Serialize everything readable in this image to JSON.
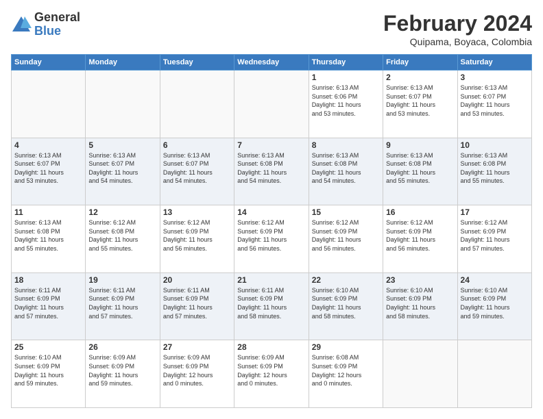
{
  "header": {
    "logo_general": "General",
    "logo_blue": "Blue",
    "title": "February 2024",
    "location": "Quipama, Boyaca, Colombia"
  },
  "days_of_week": [
    "Sunday",
    "Monday",
    "Tuesday",
    "Wednesday",
    "Thursday",
    "Friday",
    "Saturday"
  ],
  "weeks": [
    [
      {
        "num": "",
        "info": ""
      },
      {
        "num": "",
        "info": ""
      },
      {
        "num": "",
        "info": ""
      },
      {
        "num": "",
        "info": ""
      },
      {
        "num": "1",
        "info": "Sunrise: 6:13 AM\nSunset: 6:06 PM\nDaylight: 11 hours\nand 53 minutes."
      },
      {
        "num": "2",
        "info": "Sunrise: 6:13 AM\nSunset: 6:07 PM\nDaylight: 11 hours\nand 53 minutes."
      },
      {
        "num": "3",
        "info": "Sunrise: 6:13 AM\nSunset: 6:07 PM\nDaylight: 11 hours\nand 53 minutes."
      }
    ],
    [
      {
        "num": "4",
        "info": "Sunrise: 6:13 AM\nSunset: 6:07 PM\nDaylight: 11 hours\nand 53 minutes."
      },
      {
        "num": "5",
        "info": "Sunrise: 6:13 AM\nSunset: 6:07 PM\nDaylight: 11 hours\nand 54 minutes."
      },
      {
        "num": "6",
        "info": "Sunrise: 6:13 AM\nSunset: 6:07 PM\nDaylight: 11 hours\nand 54 minutes."
      },
      {
        "num": "7",
        "info": "Sunrise: 6:13 AM\nSunset: 6:08 PM\nDaylight: 11 hours\nand 54 minutes."
      },
      {
        "num": "8",
        "info": "Sunrise: 6:13 AM\nSunset: 6:08 PM\nDaylight: 11 hours\nand 54 minutes."
      },
      {
        "num": "9",
        "info": "Sunrise: 6:13 AM\nSunset: 6:08 PM\nDaylight: 11 hours\nand 55 minutes."
      },
      {
        "num": "10",
        "info": "Sunrise: 6:13 AM\nSunset: 6:08 PM\nDaylight: 11 hours\nand 55 minutes."
      }
    ],
    [
      {
        "num": "11",
        "info": "Sunrise: 6:13 AM\nSunset: 6:08 PM\nDaylight: 11 hours\nand 55 minutes."
      },
      {
        "num": "12",
        "info": "Sunrise: 6:12 AM\nSunset: 6:08 PM\nDaylight: 11 hours\nand 55 minutes."
      },
      {
        "num": "13",
        "info": "Sunrise: 6:12 AM\nSunset: 6:09 PM\nDaylight: 11 hours\nand 56 minutes."
      },
      {
        "num": "14",
        "info": "Sunrise: 6:12 AM\nSunset: 6:09 PM\nDaylight: 11 hours\nand 56 minutes."
      },
      {
        "num": "15",
        "info": "Sunrise: 6:12 AM\nSunset: 6:09 PM\nDaylight: 11 hours\nand 56 minutes."
      },
      {
        "num": "16",
        "info": "Sunrise: 6:12 AM\nSunset: 6:09 PM\nDaylight: 11 hours\nand 56 minutes."
      },
      {
        "num": "17",
        "info": "Sunrise: 6:12 AM\nSunset: 6:09 PM\nDaylight: 11 hours\nand 57 minutes."
      }
    ],
    [
      {
        "num": "18",
        "info": "Sunrise: 6:11 AM\nSunset: 6:09 PM\nDaylight: 11 hours\nand 57 minutes."
      },
      {
        "num": "19",
        "info": "Sunrise: 6:11 AM\nSunset: 6:09 PM\nDaylight: 11 hours\nand 57 minutes."
      },
      {
        "num": "20",
        "info": "Sunrise: 6:11 AM\nSunset: 6:09 PM\nDaylight: 11 hours\nand 57 minutes."
      },
      {
        "num": "21",
        "info": "Sunrise: 6:11 AM\nSunset: 6:09 PM\nDaylight: 11 hours\nand 58 minutes."
      },
      {
        "num": "22",
        "info": "Sunrise: 6:10 AM\nSunset: 6:09 PM\nDaylight: 11 hours\nand 58 minutes."
      },
      {
        "num": "23",
        "info": "Sunrise: 6:10 AM\nSunset: 6:09 PM\nDaylight: 11 hours\nand 58 minutes."
      },
      {
        "num": "24",
        "info": "Sunrise: 6:10 AM\nSunset: 6:09 PM\nDaylight: 11 hours\nand 59 minutes."
      }
    ],
    [
      {
        "num": "25",
        "info": "Sunrise: 6:10 AM\nSunset: 6:09 PM\nDaylight: 11 hours\nand 59 minutes."
      },
      {
        "num": "26",
        "info": "Sunrise: 6:09 AM\nSunset: 6:09 PM\nDaylight: 11 hours\nand 59 minutes."
      },
      {
        "num": "27",
        "info": "Sunrise: 6:09 AM\nSunset: 6:09 PM\nDaylight: 12 hours\nand 0 minutes."
      },
      {
        "num": "28",
        "info": "Sunrise: 6:09 AM\nSunset: 6:09 PM\nDaylight: 12 hours\nand 0 minutes."
      },
      {
        "num": "29",
        "info": "Sunrise: 6:08 AM\nSunset: 6:09 PM\nDaylight: 12 hours\nand 0 minutes."
      },
      {
        "num": "",
        "info": ""
      },
      {
        "num": "",
        "info": ""
      }
    ]
  ]
}
